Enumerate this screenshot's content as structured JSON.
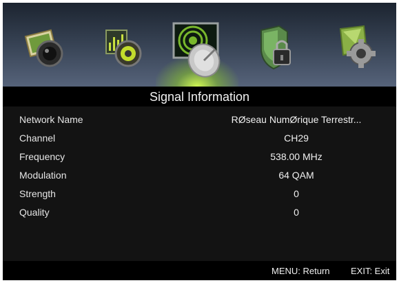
{
  "menu": {
    "items": [
      {
        "icon": "picture-camera-icon"
      },
      {
        "icon": "sound-speaker-icon"
      },
      {
        "icon": "satellite-dish-icon",
        "selected": true
      },
      {
        "icon": "lock-shield-icon"
      },
      {
        "icon": "settings-gear-icon"
      }
    ],
    "accent_color": "#b8e830"
  },
  "page": {
    "title": "Signal Information"
  },
  "signal": {
    "rows": [
      {
        "label": "Network Name",
        "value": "RØseau NumØrique Terrestr..."
      },
      {
        "label": "Channel",
        "value": "CH29"
      },
      {
        "label": "Frequency",
        "value": "538.00 MHz"
      },
      {
        "label": "Modulation",
        "value": "64 QAM"
      },
      {
        "label": "Strength",
        "value": "0"
      },
      {
        "label": "Quality",
        "value": "0"
      }
    ]
  },
  "footer": {
    "menu_hint": "MENU: Return",
    "exit_hint": "EXIT: Exit"
  }
}
